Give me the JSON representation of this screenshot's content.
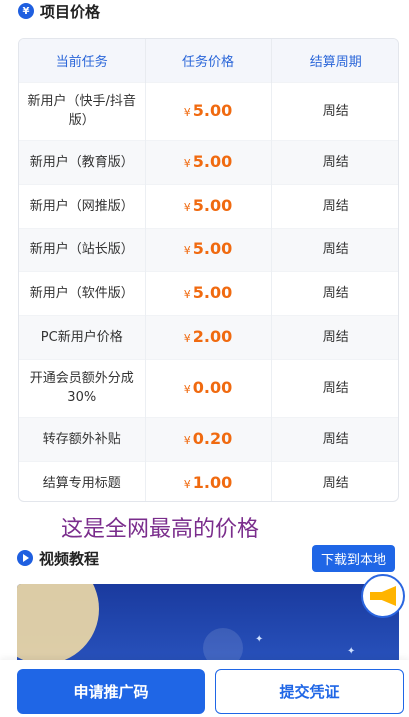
{
  "section": {
    "icon": "yen-icon",
    "icon_glyph": "¥",
    "title": "项目价格"
  },
  "table": {
    "headers": [
      "当前任务",
      "任务价格",
      "结算周期"
    ],
    "currency": "¥",
    "rows": [
      {
        "task": "新用户（快手/抖音版）",
        "price": "5.00",
        "period": "周结"
      },
      {
        "task": "新用户（教育版）",
        "price": "5.00",
        "period": "周结"
      },
      {
        "task": "新用户（网推版）",
        "price": "5.00",
        "period": "周结"
      },
      {
        "task": "新用户（站长版）",
        "price": "5.00",
        "period": "周结"
      },
      {
        "task": "新用户（软件版）",
        "price": "5.00",
        "period": "周结"
      },
      {
        "task": "PC新用户价格",
        "price": "2.00",
        "period": "周结"
      },
      {
        "task": "开通会员额外分成30%",
        "price": "0.00",
        "period": "周结"
      },
      {
        "task": "转存额外补贴",
        "price": "0.20",
        "period": "周结"
      },
      {
        "task": "结算专用标题",
        "price": "1.00",
        "period": "周结"
      }
    ]
  },
  "highlight_text": "这是全网最高的价格",
  "video": {
    "icon": "play-icon",
    "title": "视频教程",
    "download_label": "下载到本地"
  },
  "floating": {
    "icon": "megaphone-icon"
  },
  "actions": {
    "apply_label": "申请推广码",
    "submit_label": "提交凭证"
  },
  "colors": {
    "accent": "#1f66e6",
    "price": "#f06a10",
    "highlight": "#7a2d8c"
  }
}
